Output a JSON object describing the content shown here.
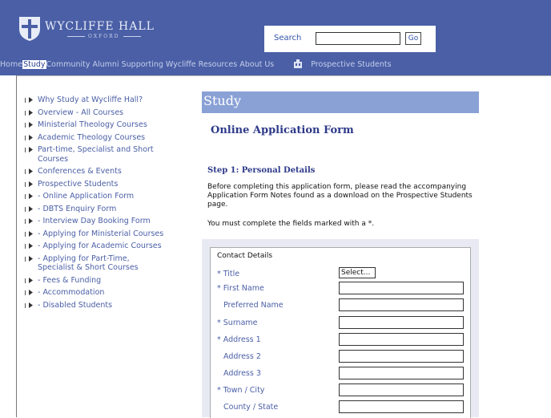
{
  "header": {
    "logo_name": "WYCLIFFE HALL",
    "logo_sub": "OXFORD",
    "search_label": "Search",
    "search_value": "",
    "go_label": "Go",
    "colors": {
      "header_bg": "#4a5fa6",
      "nav_text": "#c5ceea"
    }
  },
  "nav": {
    "items": [
      "Home",
      "Study",
      "Community",
      "Alumni",
      "Supporting Wycliffe",
      "Resources",
      "About Us"
    ],
    "active": "Study",
    "prospective_icon": "building-icon",
    "prospective_label": "Prospective Students"
  },
  "sidebar": {
    "items": [
      {
        "label": "Why Study at Wycliffe Hall?"
      },
      {
        "label": "Overview - All Courses"
      },
      {
        "label": "Ministerial Theology Courses"
      },
      {
        "label": "Academic Theology Courses"
      },
      {
        "label": "Part-time, Specialist and Short Courses"
      },
      {
        "label": "Conferences & Events"
      },
      {
        "label": "Prospective Students"
      },
      {
        "label": "- Online Application Form"
      },
      {
        "label": "- DBTS Enquiry Form"
      },
      {
        "label": "- Interview Day Booking Form"
      },
      {
        "label": "- Applying for Ministerial Courses"
      },
      {
        "label": "- Applying for Academic Courses"
      },
      {
        "label": "- Applying for Part-Time, Specialist & Short Courses"
      },
      {
        "label": "- Fees & Funding"
      },
      {
        "label": "- Accommodation"
      },
      {
        "label": "- Disabled Students"
      }
    ]
  },
  "main": {
    "section_title": "Study",
    "form_title": "Online Application Form",
    "step_title": "Step 1: Personal Details",
    "intro": "Before completing this application form, please read the accompanying Application Form Notes found as a download on the Prospective Students page.",
    "required_note": "You must complete the fields marked with a *.",
    "section_color": "#8aa1d6"
  },
  "form": {
    "legend": "Contact Details",
    "title_label": "* Title",
    "title_value": "Select...",
    "fields": [
      {
        "label": "* First Name",
        "value": ""
      },
      {
        "label": "Preferred Name",
        "value": ""
      },
      {
        "label": "* Surname",
        "value": ""
      },
      {
        "label": "* Address 1",
        "value": ""
      },
      {
        "label": "Address 2",
        "value": ""
      },
      {
        "label": "Address 3",
        "value": ""
      },
      {
        "label": "* Town / City",
        "value": ""
      },
      {
        "label": "County / State",
        "value": ""
      }
    ]
  }
}
